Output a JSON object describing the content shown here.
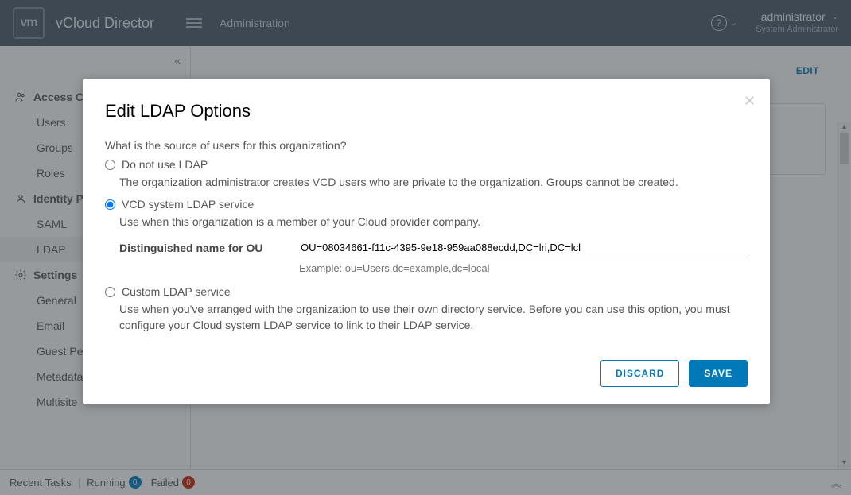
{
  "header": {
    "logo_text": "vm",
    "app_title": "vCloud Director",
    "nav_label": "Administration",
    "user_name": "administrator",
    "user_role": "System Administrator"
  },
  "sidebar": {
    "groups": [
      {
        "label": "Access Control",
        "items": [
          "Users",
          "Groups",
          "Roles"
        ]
      },
      {
        "label": "Identity Providers",
        "items": [
          "SAML",
          "LDAP"
        ]
      },
      {
        "label": "Settings",
        "items": [
          "General",
          "Email",
          "Guest Personalization",
          "Metadata",
          "Multisite"
        ]
      }
    ],
    "active_item": "LDAP"
  },
  "main": {
    "edit_label": "EDIT"
  },
  "footer": {
    "recent_tasks": "Recent Tasks",
    "running_label": "Running",
    "running_count": "0",
    "failed_label": "Failed",
    "failed_count": "0"
  },
  "modal": {
    "title": "Edit LDAP Options",
    "question": "What is the source of users for this organization?",
    "opt1_label": "Do not use LDAP",
    "opt1_desc": "The organization administrator creates VCD users who are private to the organization. Groups cannot be created.",
    "opt2_label": "VCD system LDAP service",
    "opt2_desc": "Use when this organization is a member of your Cloud provider company.",
    "ou_label": "Distinguished name for OU",
    "ou_value": "OU=08034661-f11c-4395-9e18-959aa088ecdd,DC=lri,DC=lcl",
    "ou_example": "Example: ou=Users,dc=example,dc=local",
    "opt3_label": "Custom LDAP service",
    "opt3_desc": "Use when you've arranged with the organization to use their own directory service. Before you can use this option, you must configure your Cloud system LDAP service to link to their LDAP service.",
    "selected": "opt2",
    "discard_label": "DISCARD",
    "save_label": "SAVE"
  }
}
